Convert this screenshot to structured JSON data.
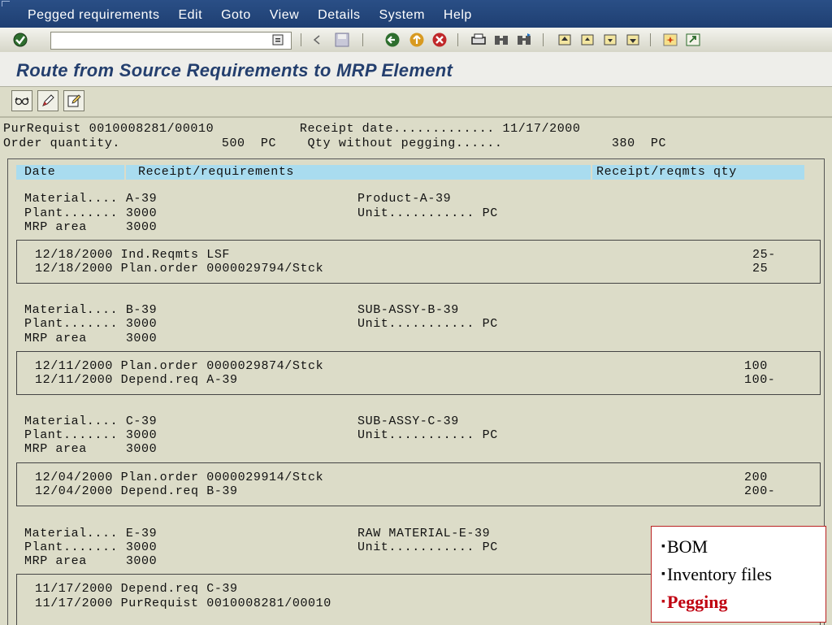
{
  "menu": [
    "Pegged requirements",
    "Edit",
    "Goto",
    "View",
    "Details",
    "System",
    "Help"
  ],
  "command_field": {
    "value": ""
  },
  "title": "Route from Source Requirements to MRP Element",
  "header": {
    "line1": "PurRequist 0010008281/00010           Receipt date............. 11/17/2000",
    "line2": "Order quantity.             500  PC    Qty without pegging......              380  PC"
  },
  "table_header": {
    "date": "Date",
    "receipt": "Receipt/requirements",
    "qty": "Receipt/reqmts qty"
  },
  "sections": [
    {
      "material_line": "Material.... A-39",
      "desc_line": "Product-A-39",
      "plant_line": "Plant....... 3000",
      "unit_line": "Unit........... PC",
      "area_line": "MRP area     3000",
      "rows": [
        {
          "text": "12/18/2000 Ind.Reqmts LSF",
          "qty": "25-"
        },
        {
          "text": "12/18/2000 Plan.order 0000029794/Stck",
          "qty": "25"
        }
      ]
    },
    {
      "material_line": "Material.... B-39",
      "desc_line": "SUB-ASSY-B-39",
      "plant_line": "Plant....... 3000",
      "unit_line": "Unit........... PC",
      "area_line": "MRP area     3000",
      "rows": [
        {
          "text": "12/11/2000 Plan.order 0000029874/Stck",
          "qty": "100"
        },
        {
          "text": "12/11/2000 Depend.req A-39",
          "qty": "100-"
        }
      ]
    },
    {
      "material_line": "Material.... C-39",
      "desc_line": "SUB-ASSY-C-39",
      "plant_line": "Plant....... 3000",
      "unit_line": "Unit........... PC",
      "area_line": "MRP area     3000",
      "rows": [
        {
          "text": "12/04/2000 Plan.order 0000029914/Stck",
          "qty": "200"
        },
        {
          "text": "12/04/2000 Depend.req B-39",
          "qty": "200-"
        }
      ]
    },
    {
      "material_line": "Material.... E-39",
      "desc_line": "RAW MATERIAL-E-39",
      "plant_line": "Plant....... 3000",
      "unit_line": "Unit........... PC",
      "area_line": "MRP area     3000",
      "rows": [
        {
          "text": "11/17/2000 Depend.req C-39",
          "qty": ""
        },
        {
          "text": "11/17/2000 PurRequist 0010008281/00010",
          "qty": ""
        }
      ]
    }
  ],
  "note": {
    "items": [
      "BOM",
      "Inventory files",
      "Pegging"
    ],
    "bullet": "▪"
  },
  "colors": {
    "menubar": "#1f3f72",
    "title": "#243f6e",
    "header_row": "#a9dcef",
    "highlight": "#c00010"
  }
}
